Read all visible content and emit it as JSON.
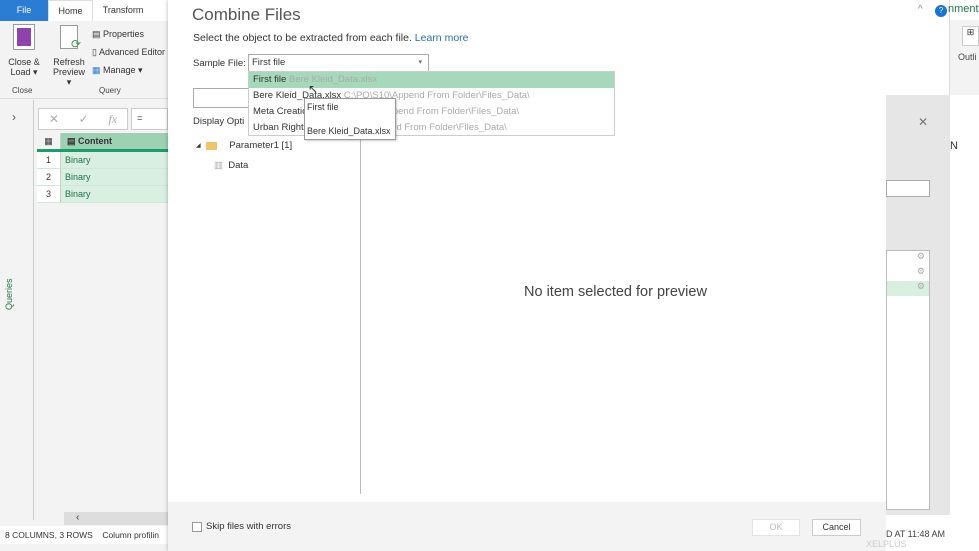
{
  "ribbon": {
    "tabs": [
      "File",
      "Home",
      "Transform"
    ],
    "close_load": "Close &",
    "close_load2": "Load ▾",
    "refresh": "Refresh",
    "refresh2": "Preview ▾",
    "properties": "Properties",
    "advanced_editor": "Advanced Editor",
    "manage": "Manage ▾",
    "group_close": "Close",
    "group_query": "Query"
  },
  "formula": {
    "text": "= Tabl",
    "fx": "fx"
  },
  "queries_label": "Queries",
  "grid": {
    "header": "Content",
    "rows": [
      {
        "n": "1",
        "v": "Binary"
      },
      {
        "n": "2",
        "v": "Binary"
      },
      {
        "n": "3",
        "v": "Binary"
      }
    ]
  },
  "status": {
    "cols": "8 COLUMNS, 3 ROWS",
    "profiling": "Column profilin"
  },
  "dialog": {
    "title": "Combine Files",
    "subtitle": "Select the object to be extracted from each file.",
    "learn_more": "Learn more",
    "sample_label": "Sample File:",
    "sample_value": "First file",
    "options": [
      {
        "name": "First file",
        "path": "Bere Kleid_Data.xlsx"
      },
      {
        "name": "Bere Kleid_Data.xlsx",
        "path": "C:\\PQ\\S10\\Append From Folder\\Files_Data\\"
      },
      {
        "name": "Meta Creatio",
        "path": "10\\Append From Folder\\Files_Data\\"
      },
      {
        "name": "Urban Right",
        "path": "\\Append From Folder\\Files_Data\\"
      }
    ],
    "tooltip": {
      "line1": "First file",
      "line2": "Bere Kleid_Data.xlsx"
    },
    "display_options": "Display Opti",
    "tree": {
      "parent": "Parameter1 [1]",
      "child": "Data"
    },
    "preview_empty": "No item selected for preview",
    "skip_errors": "Skip files with errors",
    "ok": "OK",
    "cancel": "Cancel"
  },
  "excel": {
    "ribbon_text": "nment",
    "outline": "Outli",
    "column": "N",
    "status": "D AT 11:48 AM",
    "watermark": "XELPLUS"
  },
  "colors": {
    "accent": "#217346",
    "file_tab": "#2b7cd3",
    "highlight": "#a6d8bb"
  }
}
